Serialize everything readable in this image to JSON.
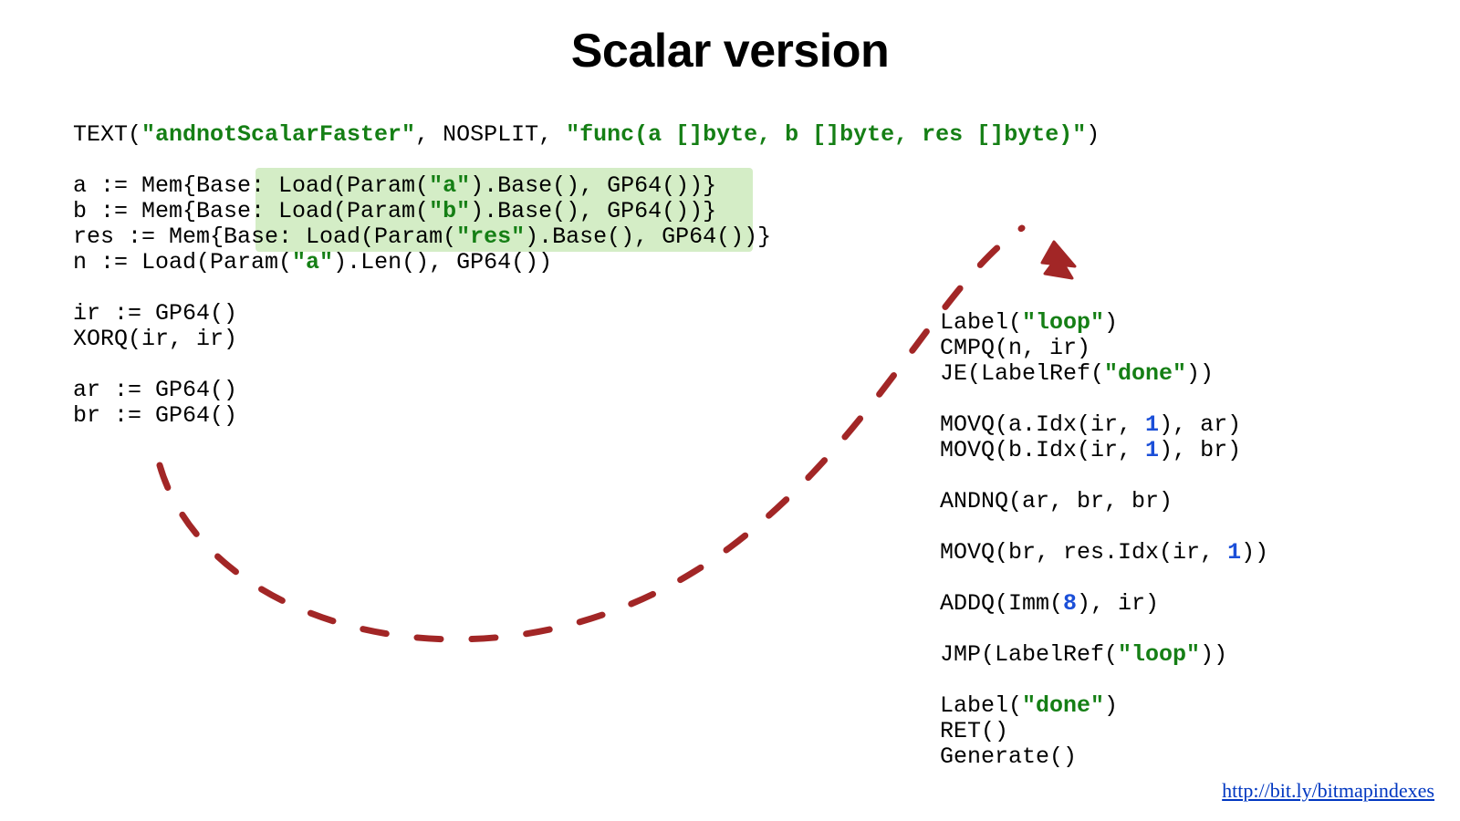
{
  "title": "Scalar version",
  "footer_link_text": "http://bit.ly/bitmapindexes",
  "colors": {
    "string": "#157f15",
    "number": "#1b4fd8",
    "highlight": "#d4edc6",
    "arrow": "#a22626"
  },
  "code_left": {
    "l01_a": "TEXT(",
    "l01_s1": "\"andnotScalarFaster\"",
    "l01_b": ", NOSPLIT, ",
    "l01_s2": "\"func(a []byte, b []byte, res []byte)\"",
    "l01_c": ")",
    "l02": "",
    "l03_a": "a := Mem{Base: Load(Param(",
    "l03_s": "\"a\"",
    "l03_b": ").Base(), GP64())}",
    "l04_a": "b := Mem{Base: Load(Param(",
    "l04_s": "\"b\"",
    "l04_b": ").Base(), GP64())}",
    "l05_a": "res := Mem{Base: Load(Param(",
    "l05_s": "\"res\"",
    "l05_b": ").Base(), GP64())}",
    "l06_a": "n := Load(Param(",
    "l06_s": "\"a\"",
    "l06_b": ").Len(), GP64())",
    "l07": "",
    "l08": "ir := GP64()",
    "l09": "XORQ(ir, ir)",
    "l10": "",
    "l11": "ar := GP64()",
    "l12": "br := GP64()"
  },
  "code_right": {
    "r01_a": "Label(",
    "r01_s": "\"loop\"",
    "r01_b": ")",
    "r02": "CMPQ(n, ir)",
    "r03_a": "JE(LabelRef(",
    "r03_s": "\"done\"",
    "r03_b": "))",
    "r04": "",
    "r05_a": "MOVQ(a.Idx(ir, ",
    "r05_n": "1",
    "r05_b": "), ar)",
    "r06_a": "MOVQ(b.Idx(ir, ",
    "r06_n": "1",
    "r06_b": "), br)",
    "r07": "",
    "r08": "ANDNQ(ar, br, br)",
    "r09": "",
    "r10_a": "MOVQ(br, res.Idx(ir, ",
    "r10_n": "1",
    "r10_b": "))",
    "r11": "",
    "r12_a": "ADDQ(Imm(",
    "r12_n": "8",
    "r12_b": "), ir)",
    "r13": "",
    "r14_a": "JMP(LabelRef(",
    "r14_s": "\"loop\"",
    "r14_b": "))",
    "r15": "",
    "r16_a": "Label(",
    "r16_s": "\"done\"",
    "r16_b": ")",
    "r17": "RET()",
    "r18": "Generate()"
  }
}
